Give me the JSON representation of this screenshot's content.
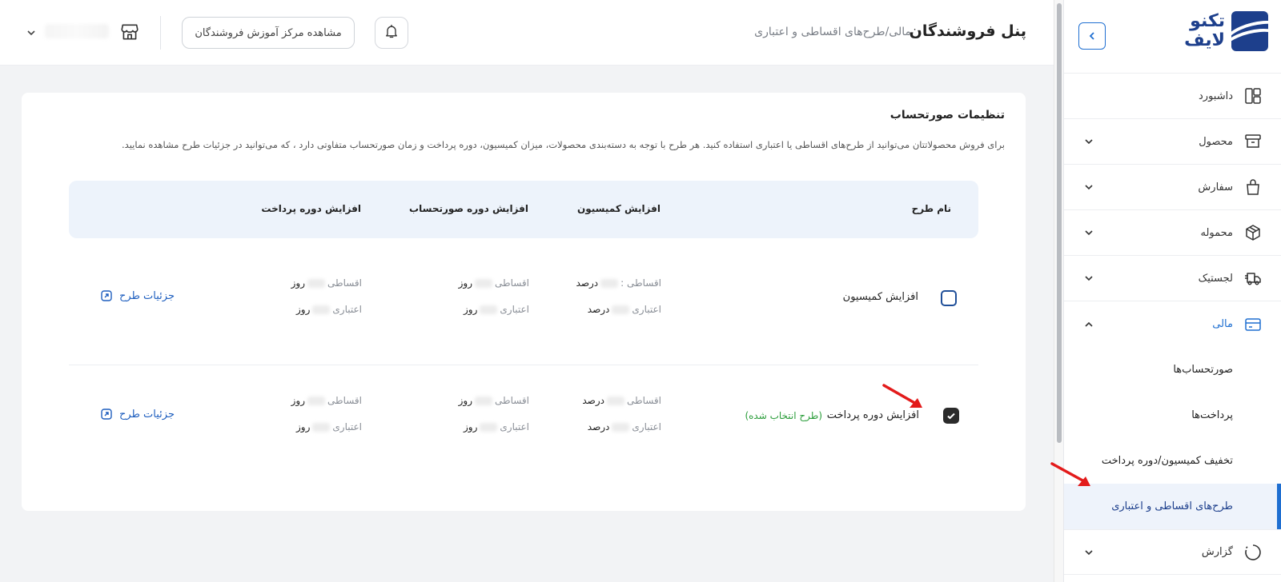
{
  "sidebar": {
    "logo": {
      "line1": "تکنو",
      "line2": "لایف",
      "brand_color": "#1d3f8c"
    },
    "collapse_icon": "chevron-left-icon",
    "items": [
      {
        "label": "داشبورد",
        "icon": "dashboard-icon",
        "has_chevron": false
      },
      {
        "label": "محصول",
        "icon": "box-icon",
        "has_chevron": true
      },
      {
        "label": "سفارش",
        "icon": "bag-icon",
        "has_chevron": true
      },
      {
        "label": "محموله",
        "icon": "package-icon",
        "has_chevron": true
      },
      {
        "label": "لجستیک",
        "icon": "truck-icon",
        "has_chevron": true
      },
      {
        "label": "مالی",
        "icon": "card-icon",
        "has_chevron": true,
        "expanded": true
      }
    ],
    "sub_items": [
      {
        "label": "صورتحساب‌ها"
      },
      {
        "label": "پرداخت‌ها"
      },
      {
        "label": "تخفیف کمیسیون/دوره پرداخت"
      },
      {
        "label": "طرح‌های اقساطی و اعتباری",
        "active": true
      }
    ],
    "report_item": {
      "label": "گزارش",
      "icon": "report-icon"
    }
  },
  "header": {
    "title": "پنل فروشندگان",
    "breadcrumb": "مالی/طرح‌های اقساطی و اعتباری",
    "learn_button": "مشاهده مرکز آموزش فروشندگان"
  },
  "card": {
    "title": "تنظیمات صورتحساب",
    "description": "برای فروش محصولاتتان می‌توانید از طرح‌های اقساطی یا اعتباری استفاده کنید. هر طرح با توجه به دسته‌بندی محصولات، میزان کمیسیون، دوره پرداخت و زمان صورتحساب متفاوتی دارد ، که می‌توانید در جزئیات طرح مشاهده نمایید.",
    "columns": [
      "نام طرح",
      "افزایش کمیسیون",
      "افزایش دوره صورتحساب",
      "افزایش دوره پرداخت"
    ],
    "rows": [
      {
        "name": "افزایش کمیسیون",
        "selected": false,
        "selected_label": "",
        "commission": {
          "installment_label": "اقساطی :",
          "installment_unit": "درصد",
          "credit_label": "اعتباری",
          "credit_unit": "درصد"
        },
        "billing": {
          "installment_label": "اقساطی",
          "installment_unit": "روز",
          "credit_label": "اعتباری",
          "credit_unit": "روز"
        },
        "payment": {
          "installment_label": "اقساطی",
          "installment_unit": "روز",
          "credit_label": "اعتباری",
          "credit_unit": "روز"
        },
        "details": "جزئیات طرح"
      },
      {
        "name": "افزایش دوره پرداخت",
        "selected": true,
        "selected_label": "(طرح انتخاب شده)",
        "commission": {
          "installment_label": "اقساطی",
          "installment_unit": "درصد",
          "credit_label": "اعتباری",
          "credit_unit": "درصد"
        },
        "billing": {
          "installment_label": "اقساطی",
          "installment_unit": "روز",
          "credit_label": "اعتباری",
          "credit_unit": "روز"
        },
        "payment": {
          "installment_label": "اقساطی",
          "installment_unit": "روز",
          "credit_label": "اعتباری",
          "credit_unit": "روز"
        },
        "details": "جزئیات طرح"
      }
    ]
  },
  "colors": {
    "accent": "#1f6fd1",
    "selected_green": "#2a9d3a",
    "annotation_arrow": "#e31b1b"
  }
}
